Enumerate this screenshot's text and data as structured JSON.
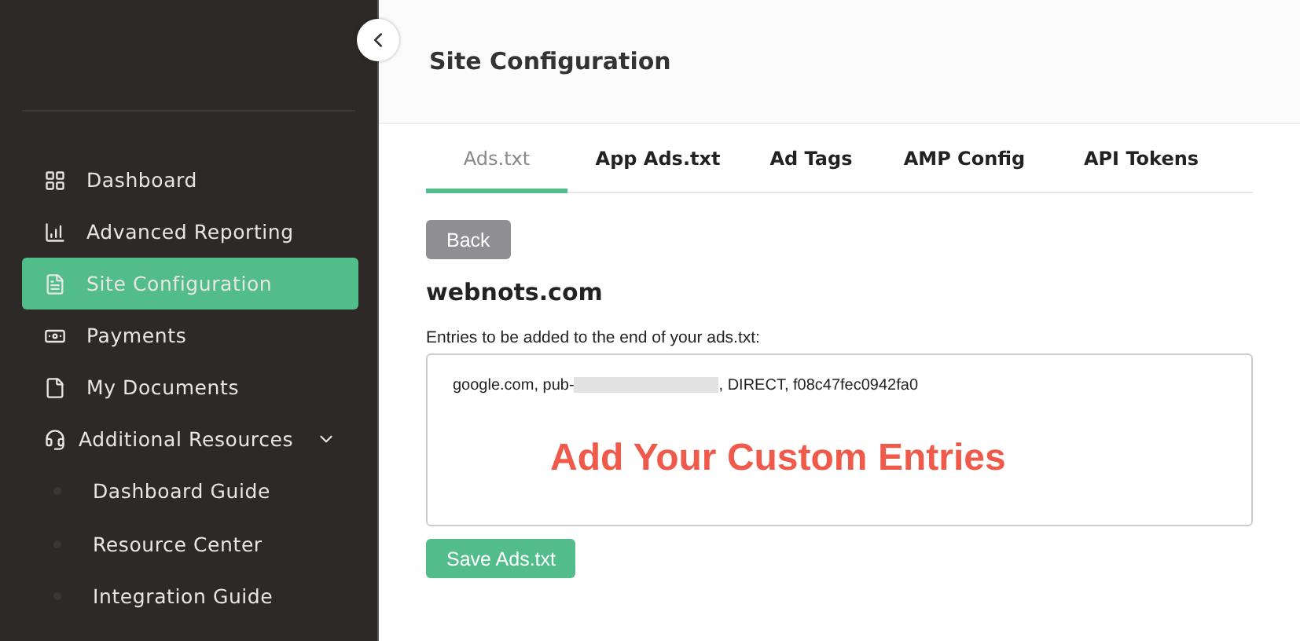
{
  "sidebar": {
    "items": [
      {
        "label": "Dashboard",
        "selected": false
      },
      {
        "label": "Advanced Reporting",
        "selected": false
      },
      {
        "label": "Site Configuration",
        "selected": true
      },
      {
        "label": "Payments",
        "selected": false
      },
      {
        "label": "My Documents",
        "selected": false
      },
      {
        "label": "Additional Resources",
        "selected": false,
        "expanded": true,
        "children": [
          {
            "label": "Dashboard Guide",
            "selected": false
          },
          {
            "label": "Resource Center",
            "selected": false
          },
          {
            "label": "Integration Guide",
            "selected": false
          }
        ]
      }
    ]
  },
  "header": {
    "title": "Site Configuration"
  },
  "tabs": [
    {
      "label": "Ads.txt",
      "selected": true
    },
    {
      "label": "App Ads.txt",
      "selected": false
    },
    {
      "label": "Ad Tags",
      "selected": false
    },
    {
      "label": "AMP Config",
      "selected": false
    },
    {
      "label": "API Tokens",
      "selected": false
    }
  ],
  "back_button": "Back",
  "site": "webnots.com",
  "entries": {
    "label": "Entries to be added to the end of your ads.txt:",
    "line_start": "google.com, pub-",
    "redacted": true,
    "line_end": ", DIRECT, f08c47fec0942fa0"
  },
  "annotation": "Add Your Custom Entries",
  "save_button": "Save Ads.txt"
}
